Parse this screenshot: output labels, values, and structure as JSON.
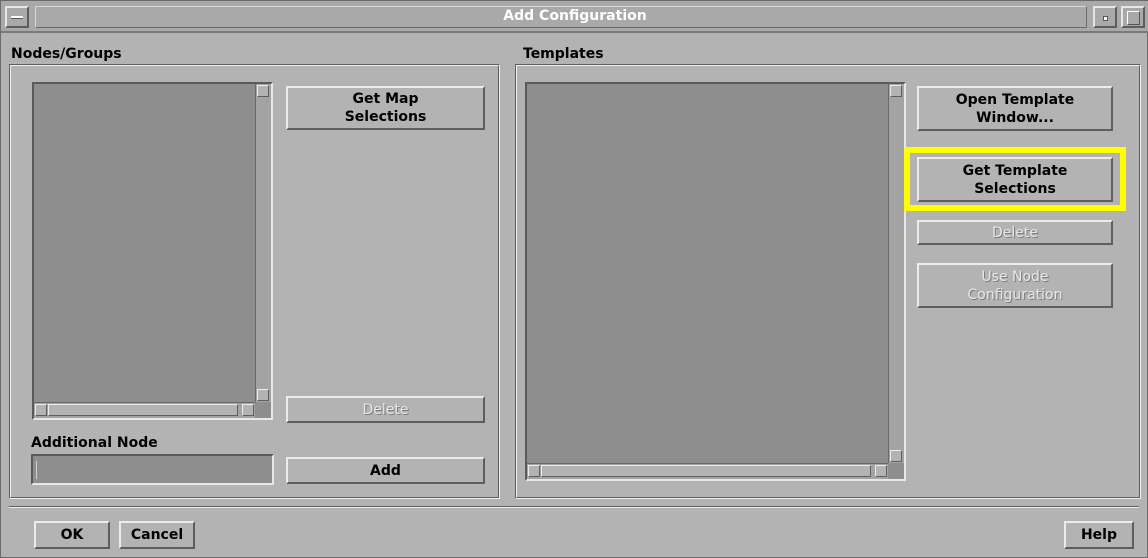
{
  "window": {
    "title": "Add Configuration"
  },
  "nodes_groups": {
    "label": "Nodes/Groups",
    "get_map_selections": "Get Map\nSelections",
    "delete": "Delete",
    "additional_node_label": "Additional Node",
    "additional_node_value": "",
    "add": "Add"
  },
  "templates": {
    "label": "Templates",
    "open_template_window": "Open Template\nWindow...",
    "get_template_selections": "Get Template\nSelections",
    "delete": "Delete",
    "use_node_configuration": "Use Node\nConfiguration"
  },
  "footer": {
    "ok": "OK",
    "cancel": "Cancel",
    "help": "Help"
  },
  "colors": {
    "highlight": "#ffff00",
    "background": "#b3b3b3",
    "list_background": "#8e8e8e"
  }
}
